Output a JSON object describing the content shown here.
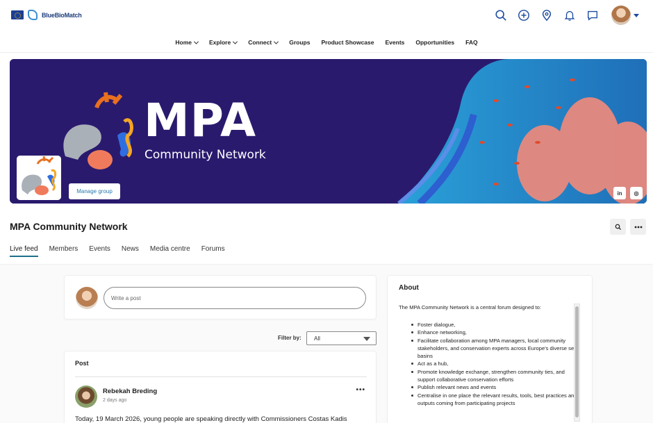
{
  "brand": {
    "name": "BlueBioMatch"
  },
  "top_icons": [
    "search-icon",
    "add-icon",
    "location-icon",
    "bell-icon",
    "chat-icon"
  ],
  "nav": [
    {
      "label": "Home",
      "dropdown": true
    },
    {
      "label": "Explore",
      "dropdown": true
    },
    {
      "label": "Connect",
      "dropdown": true
    },
    {
      "label": "Groups",
      "dropdown": false
    },
    {
      "label": "Product Showcase",
      "dropdown": false
    },
    {
      "label": "Events",
      "dropdown": false
    },
    {
      "label": "Opportunities",
      "dropdown": false
    },
    {
      "label": "FAQ",
      "dropdown": false
    }
  ],
  "banner": {
    "title": "MPA",
    "subtitle": "Community Network",
    "manage_label": "Manage group",
    "socials": [
      "in",
      "◎"
    ]
  },
  "group": {
    "title": "MPA Community Network"
  },
  "tabs": [
    "Live feed",
    "Members",
    "Events",
    "News",
    "Media centre",
    "Forums"
  ],
  "composer": {
    "placeholder": "Write a post"
  },
  "filter": {
    "label": "Filter by:",
    "value": "All"
  },
  "post": {
    "heading": "Post",
    "author": "Rebekah Breding",
    "time": "2 days ago",
    "text": "Today, 19 March 2026, young people are speaking directly with Commissioners Costas Kadis"
  },
  "about": {
    "title": "About",
    "intro": "The MPA Community Network is a central forum designed to:",
    "items": [
      "Foster dialogue,",
      "Enhance networking,",
      "Facilitate collaboration among MPA managers, local community stakeholders, and conservation experts across Europe's diverse sea basins",
      "Act as a hub,",
      "Promote knowledge exchange, strengthen community ties, and support collaborative conservation efforts",
      "Publish relevant news and events",
      "Centralise in one place the relevant results, tools, best practices and outputs coming from participating projects"
    ]
  },
  "colors": {
    "banner_bg": "#2a1a6e",
    "accent": "#1e6f8c",
    "brand_blue": "#1c3d7a"
  }
}
